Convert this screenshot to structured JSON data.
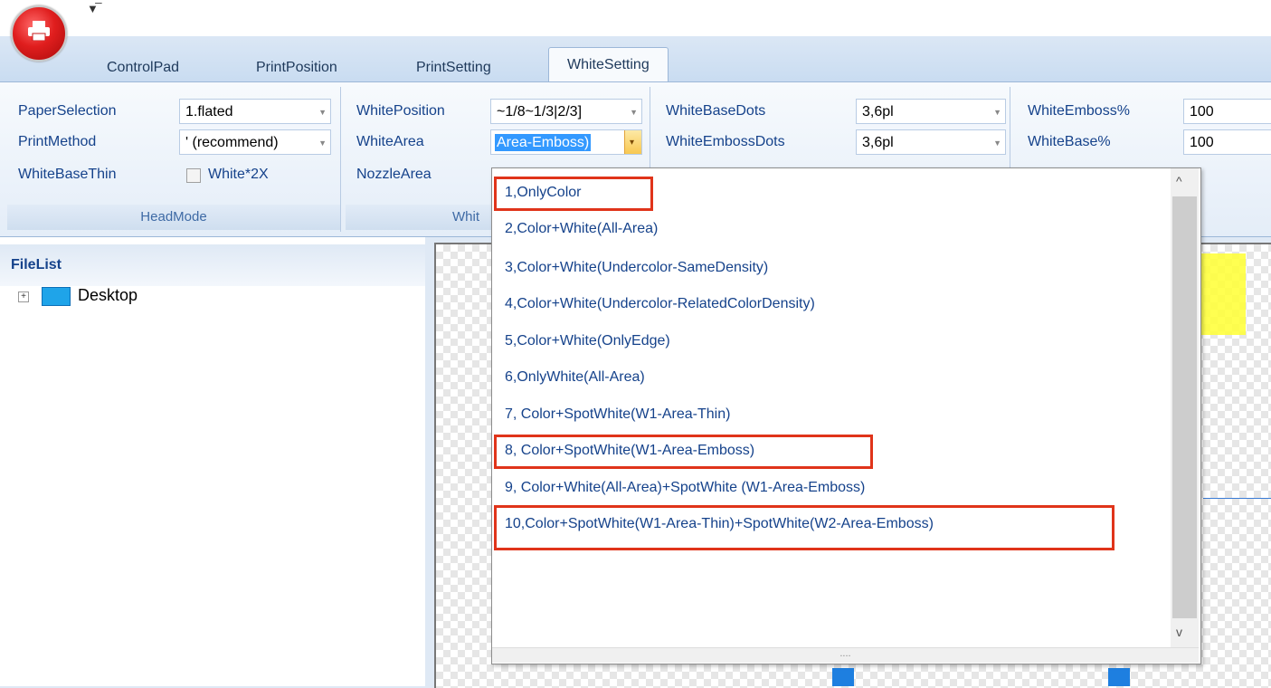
{
  "qat_icon": "customize-quick-access-icon",
  "tabs": [
    "ControlPad",
    "PrintPosition",
    "PrintSetting",
    "WhiteSetting"
  ],
  "active_tab": "WhiteSetting",
  "headmode": {
    "group_label": "HeadMode",
    "paper_label": "PaperSelection",
    "paper_value": "1.flated",
    "method_label": "PrintMethod",
    "method_value": "' (recommend)",
    "basethin_label": "WhiteBaseThin",
    "white2x_label": "White*2X"
  },
  "white": {
    "group_label": "Whit",
    "position_label": "WhitePosition",
    "position_value": "~1/8~1/3|2/3]",
    "area_label": "WhiteArea",
    "area_value": "Area-Emboss)",
    "nozzle_label": "NozzleArea"
  },
  "dots": {
    "base_dots_label": "WhiteBaseDots",
    "base_dots_value": "3,6pl",
    "emboss_dots_label": "WhiteEmbossDots",
    "emboss_dots_value": "3,6pl"
  },
  "percent": {
    "emboss_label": "WhiteEmboss%",
    "emboss_value": "100",
    "base_label": "WhiteBase%",
    "base_value": "100"
  },
  "filelist": {
    "header": "FileList",
    "expander": "+",
    "root": "Desktop"
  },
  "white_area_options": [
    "1,OnlyColor",
    "2,Color+White(All-Area)",
    "3,Color+White(Undercolor-SameDensity)",
    "4,Color+White(Undercolor-RelatedColorDensity)",
    "5,Color+White(OnlyEdge)",
    "6,OnlyWhite(All-Area)",
    "7, Color+SpotWhite(W1-Area-Thin)",
    "8, Color+SpotWhite(W1-Area-Emboss)",
    "9, Color+White(All-Area)+SpotWhite (W1-Area-Emboss)",
    "10,Color+SpotWhite(W1-Area-Thin)+SpotWhite(W2-Area-Emboss)"
  ],
  "highlighted_options": [
    1,
    8,
    10
  ],
  "highlight_color": "#e0341a",
  "grip_text": "....",
  "scroll_up": "^",
  "scroll_down": "v"
}
